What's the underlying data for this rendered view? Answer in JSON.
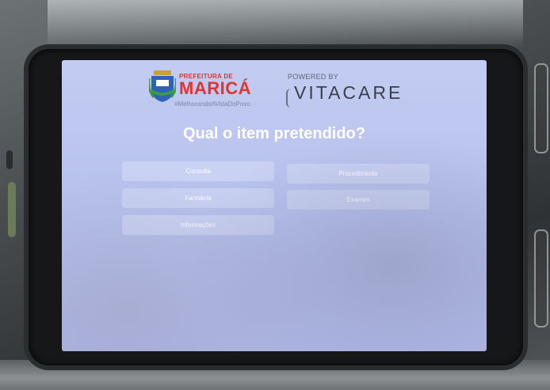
{
  "header": {
    "prefeitura_label": "PREFEITURA DE",
    "municipality_name": "MARICÁ",
    "slogan": "#MelhorandoAVidaDoPovo",
    "powered_by": "POWERED BY",
    "vendor_name": "VITACARE"
  },
  "question": "Qual o item pretendido?",
  "options": [
    {
      "label": "Consulta"
    },
    {
      "label": "Procedimento"
    },
    {
      "label": "Farmácia"
    },
    {
      "label": "Exames"
    },
    {
      "label": "Informações"
    }
  ],
  "colors": {
    "screen_background": "#b8c2ee",
    "marica_red": "#e0342f",
    "vitacare_text": "#3a4049",
    "button_text": "#ffffff"
  }
}
